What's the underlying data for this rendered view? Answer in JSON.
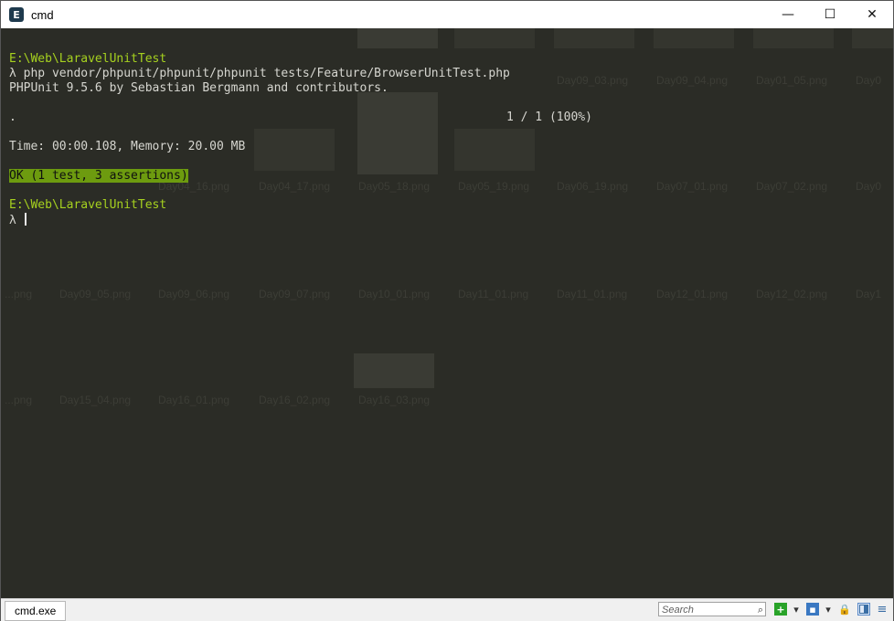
{
  "window": {
    "title": "cmd",
    "app_icon_glyph": "E",
    "controls": {
      "minimize": "—",
      "maximize": "☐",
      "close": "✕"
    }
  },
  "background_files": {
    "row1": [
      "Day09_03.png",
      "Day09_04.png",
      "Day01_05.png",
      "Day0"
    ],
    "row2": [
      "Day04_16.png",
      "Day04_17.png",
      "Day05_18.png",
      "Day05_19.png",
      "Day06_19.png",
      "Day07_01.png",
      "Day07_02.png",
      "Day0"
    ],
    "row3": [
      "...png",
      "Day09_05.png",
      "Day09_06.png",
      "Day09_07.png",
      "Day10_01.png",
      "Day11_01.png",
      "Day11_01.png",
      "Day12_01.png",
      "Day12_02.png",
      "Day1"
    ],
    "row4": [
      "...png",
      "Day15_04.png",
      "Day16_01.png",
      "Day16_02.png",
      "Day16_03.png"
    ]
  },
  "console": {
    "line1": "E:\\Web\\LaravelUnitTest",
    "line2": "λ php vendor/phpunit/phpunit/phpunit tests/Feature/BrowserUnitTest.php",
    "line3": "PHPUnit 9.5.6 by Sebastian Bergmann and contributors.",
    "line4_dot": ".",
    "line4_progress": "1 / 1 (100%)",
    "line5": "Time: 00:00.108, Memory: 20.00 MB",
    "line6": "OK (1 test, 3 assertions)",
    "line7": "E:\\Web\\LaravelUnitTest",
    "line8_prompt": "λ "
  },
  "statusbar": {
    "tab_label": "cmd.exe",
    "search_placeholder": "Search",
    "icons": [
      "search-icon",
      "add-console-icon",
      "dropdown-icon",
      "view-icon",
      "dropdown-icon",
      "lock-icon",
      "split-view-icon",
      "menu-icon"
    ]
  },
  "colors": {
    "console_bg": "#2b2c26",
    "path_green": "#a6d11f",
    "ok_badge_bg": "#6d9b0f"
  }
}
